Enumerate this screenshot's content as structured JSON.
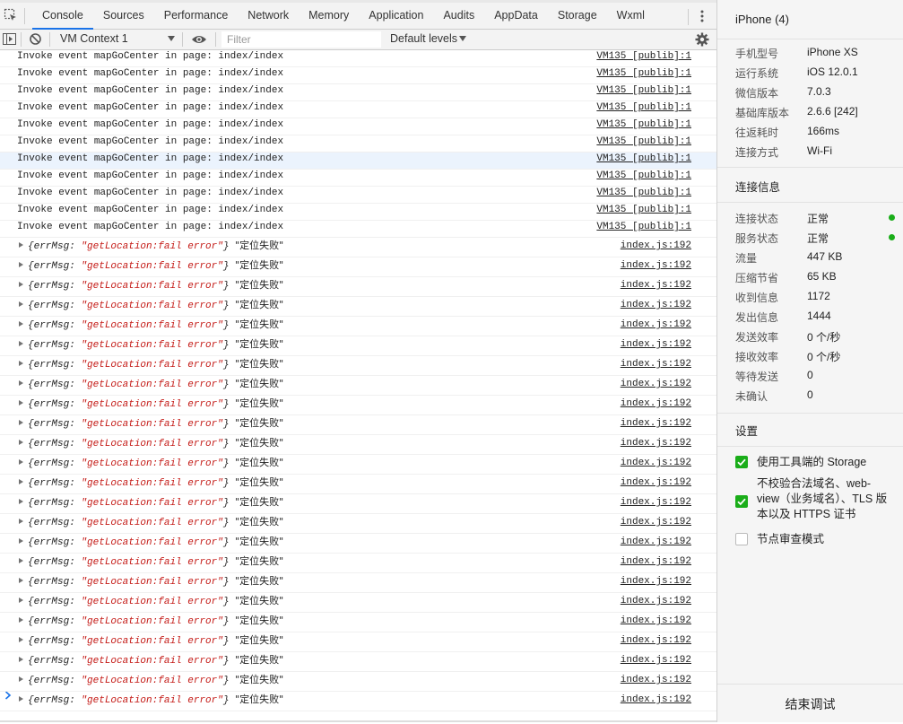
{
  "tabs": [
    "Console",
    "Sources",
    "Performance",
    "Network",
    "Memory",
    "Application",
    "Audits",
    "AppData",
    "Storage",
    "Wxml"
  ],
  "active_tab": "Console",
  "toolbar": {
    "context": "VM Context 1",
    "filter_placeholder": "Filter",
    "levels": "Default levels"
  },
  "console": {
    "invoke_rows": [
      {
        "msg": "Invoke event mapGoCenter in page: index/index",
        "src": "VM135 [publib]:1"
      },
      {
        "msg": "Invoke event mapGoCenter in page: index/index",
        "src": "VM135 [publib]:1"
      },
      {
        "msg": "Invoke event mapGoCenter in page: index/index",
        "src": "VM135 [publib]:1"
      },
      {
        "msg": "Invoke event mapGoCenter in page: index/index",
        "src": "VM135 [publib]:1"
      },
      {
        "msg": "Invoke event mapGoCenter in page: index/index",
        "src": "VM135 [publib]:1"
      },
      {
        "msg": "Invoke event mapGoCenter in page: index/index",
        "src": "VM135 [publib]:1"
      },
      {
        "msg": "Invoke event mapGoCenter in page: index/index",
        "src": "VM135 [publib]:1"
      },
      {
        "msg": "Invoke event mapGoCenter in page: index/index",
        "src": "VM135 [publib]:1"
      },
      {
        "msg": "Invoke event mapGoCenter in page: index/index",
        "src": "VM135 [publib]:1"
      },
      {
        "msg": "Invoke event mapGoCenter in page: index/index",
        "src": "VM135 [publib]:1"
      },
      {
        "msg": "Invoke event mapGoCenter in page: index/index",
        "src": "VM135 [publib]:1"
      }
    ],
    "highlighted_row": 6,
    "error_rows": [
      {
        "key": "errMsg: ",
        "val": "\"getLocation:fail error\"",
        "text": "\"定位失败\"",
        "src": "index.js:192"
      },
      {
        "key": "errMsg: ",
        "val": "\"getLocation:fail error\"",
        "text": "\"定位失败\"",
        "src": "index.js:192"
      },
      {
        "key": "errMsg: ",
        "val": "\"getLocation:fail error\"",
        "text": "\"定位失败\"",
        "src": "index.js:192"
      },
      {
        "key": "errMsg: ",
        "val": "\"getLocation:fail error\"",
        "text": "\"定位失败\"",
        "src": "index.js:192"
      },
      {
        "key": "errMsg: ",
        "val": "\"getLocation:fail error\"",
        "text": "\"定位失败\"",
        "src": "index.js:192"
      },
      {
        "key": "errMsg: ",
        "val": "\"getLocation:fail error\"",
        "text": "\"定位失败\"",
        "src": "index.js:192"
      },
      {
        "key": "errMsg: ",
        "val": "\"getLocation:fail error\"",
        "text": "\"定位失败\"",
        "src": "index.js:192"
      },
      {
        "key": "errMsg: ",
        "val": "\"getLocation:fail error\"",
        "text": "\"定位失败\"",
        "src": "index.js:192"
      },
      {
        "key": "errMsg: ",
        "val": "\"getLocation:fail error\"",
        "text": "\"定位失败\"",
        "src": "index.js:192"
      },
      {
        "key": "errMsg: ",
        "val": "\"getLocation:fail error\"",
        "text": "\"定位失败\"",
        "src": "index.js:192"
      },
      {
        "key": "errMsg: ",
        "val": "\"getLocation:fail error\"",
        "text": "\"定位失败\"",
        "src": "index.js:192"
      },
      {
        "key": "errMsg: ",
        "val": "\"getLocation:fail error\"",
        "text": "\"定位失败\"",
        "src": "index.js:192"
      },
      {
        "key": "errMsg: ",
        "val": "\"getLocation:fail error\"",
        "text": "\"定位失败\"",
        "src": "index.js:192"
      },
      {
        "key": "errMsg: ",
        "val": "\"getLocation:fail error\"",
        "text": "\"定位失败\"",
        "src": "index.js:192"
      },
      {
        "key": "errMsg: ",
        "val": "\"getLocation:fail error\"",
        "text": "\"定位失败\"",
        "src": "index.js:192"
      },
      {
        "key": "errMsg: ",
        "val": "\"getLocation:fail error\"",
        "text": "\"定位失败\"",
        "src": "index.js:192"
      },
      {
        "key": "errMsg: ",
        "val": "\"getLocation:fail error\"",
        "text": "\"定位失败\"",
        "src": "index.js:192"
      },
      {
        "key": "errMsg: ",
        "val": "\"getLocation:fail error\"",
        "text": "\"定位失败\"",
        "src": "index.js:192"
      },
      {
        "key": "errMsg: ",
        "val": "\"getLocation:fail error\"",
        "text": "\"定位失败\"",
        "src": "index.js:192"
      },
      {
        "key": "errMsg: ",
        "val": "\"getLocation:fail error\"",
        "text": "\"定位失败\"",
        "src": "index.js:192"
      },
      {
        "key": "errMsg: ",
        "val": "\"getLocation:fail error\"",
        "text": "\"定位失败\"",
        "src": "index.js:192"
      },
      {
        "key": "errMsg: ",
        "val": "\"getLocation:fail error\"",
        "text": "\"定位失败\"",
        "src": "index.js:192"
      },
      {
        "key": "errMsg: ",
        "val": "\"getLocation:fail error\"",
        "text": "\"定位失败\"",
        "src": "index.js:192"
      },
      {
        "key": "errMsg: ",
        "val": "\"getLocation:fail error\"",
        "text": "\"定位失败\"",
        "src": "index.js:192"
      }
    ]
  },
  "panel": {
    "title": "iPhone (4)",
    "device_info": [
      {
        "k": "手机型号",
        "v": "iPhone XS"
      },
      {
        "k": "运行系统",
        "v": "iOS 12.0.1"
      },
      {
        "k": "微信版本",
        "v": "7.0.3"
      },
      {
        "k": "基础库版本",
        "v": "2.6.6 [242]"
      },
      {
        "k": "往返耗时",
        "v": "166ms"
      },
      {
        "k": "连接方式",
        "v": "Wi-Fi"
      }
    ],
    "conn_title": "连接信息",
    "conn_info": [
      {
        "k": "连接状态",
        "v": "正常",
        "dot": true
      },
      {
        "k": "服务状态",
        "v": "正常",
        "dot": true
      },
      {
        "k": "流量",
        "v": "447 KB"
      },
      {
        "k": "压缩节省",
        "v": "65 KB"
      },
      {
        "k": "收到信息",
        "v": "1172"
      },
      {
        "k": "发出信息",
        "v": "1444"
      },
      {
        "k": "发送效率",
        "v": "0 个/秒"
      },
      {
        "k": "接收效率",
        "v": "0 个/秒"
      },
      {
        "k": "等待发送",
        "v": "0"
      },
      {
        "k": "未确认",
        "v": "0"
      }
    ],
    "settings_title": "设置",
    "settings": [
      {
        "label": "使用工具端的 Storage",
        "checked": true
      },
      {
        "label": "不校验合法域名、web-view（业务域名）、TLS 版本以及 HTTPS 证书",
        "checked": true
      },
      {
        "label": "节点审查模式",
        "checked": false
      }
    ],
    "end_button": "结束调试"
  },
  "colors": {
    "accent": "#1a73e8",
    "green": "#1aad19",
    "string_red": "#c41a16"
  }
}
